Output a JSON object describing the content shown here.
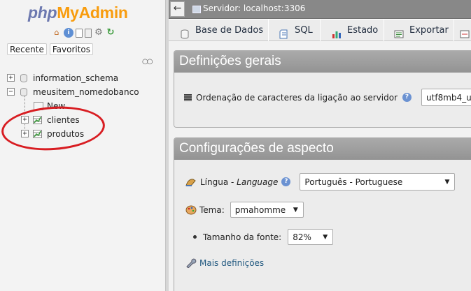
{
  "nav": {
    "logo": {
      "php": "php",
      "my": "My",
      "admin": "Admin"
    },
    "icons": [
      "home-icon",
      "info-icon",
      "docs-icon",
      "sql-docs-icon",
      "settings-gear-icon",
      "reload-icon"
    ],
    "tabs": {
      "recent": "Recente",
      "favorites": "Favoritos"
    },
    "tree": {
      "db1": "information_schema",
      "db2": "meusitem_nomedobanco",
      "new": "New",
      "table1": "clientes",
      "table2": "produtos"
    }
  },
  "topbar": {
    "server": "Servidor: localhost:3306"
  },
  "menu": [
    {
      "label": "Base de Dados",
      "icon": "database-icon"
    },
    {
      "label": "SQL",
      "icon": "sql-icon"
    },
    {
      "label": "Estado",
      "icon": "status-chart-icon"
    },
    {
      "label": "Exportar",
      "icon": "export-icon"
    }
  ],
  "general": {
    "title": "Definições gerais",
    "collation_label": "Ordenação de caracteres da ligação ao servidor",
    "collation_value": "utf8mb4_u"
  },
  "appearance": {
    "title": "Configurações de aspecto",
    "language_label": "Língua",
    "language_sep": " - ",
    "language_label_en": "Language",
    "language_value": "Português - Portuguese",
    "theme_label": "Tema:",
    "theme_value": "pmahomme",
    "font_label": "Tamanho da fonte:",
    "font_value": "82%",
    "more": "Mais definições"
  },
  "colors": {
    "accent": "#235a81",
    "annotation": "#d81d22",
    "logo_blue": "#6c78af",
    "logo_orange": "#f89c0e"
  }
}
